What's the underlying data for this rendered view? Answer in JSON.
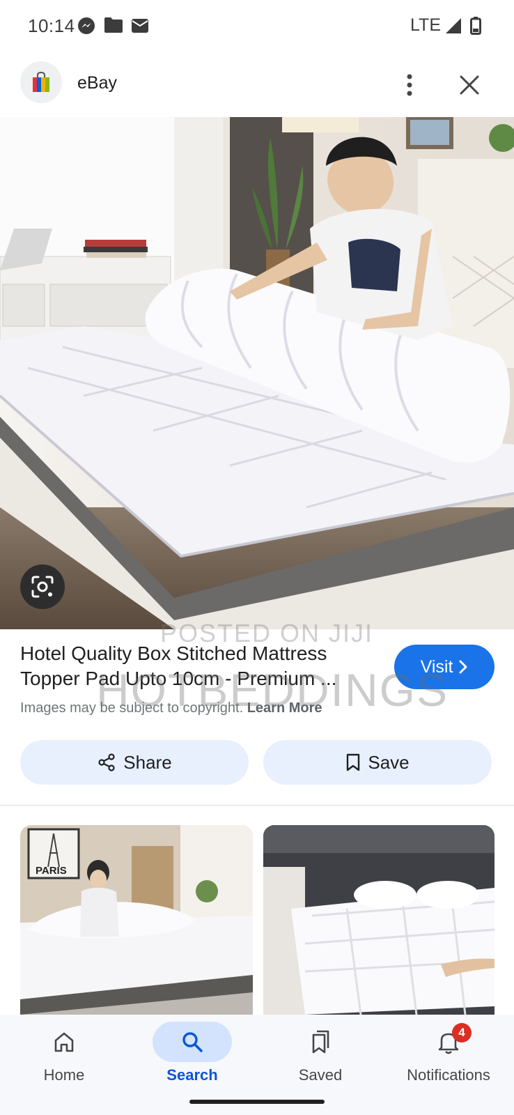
{
  "status_bar": {
    "time": "10:14",
    "network": "LTE"
  },
  "header": {
    "title": "eBay"
  },
  "result": {
    "title_line1": "Hotel Quality Box Stitched Mattress",
    "title_line2": "Topper Pad Upto 10cm - Premium ...",
    "visit_label": "Visit",
    "copyright_text": "Images may be subject to copyright.",
    "learn_more": "Learn More"
  },
  "actions": {
    "share_label": "Share",
    "save_label": "Save"
  },
  "watermark": {
    "line1": "POSTED ON JIJI",
    "line2": "HOTBEDDINGS"
  },
  "thumbnails": {
    "left_poster_text": "PARIS"
  },
  "bottom_nav": {
    "items": [
      {
        "label": "Home",
        "icon": "home-icon",
        "active": false
      },
      {
        "label": "Search",
        "icon": "search-icon",
        "active": true
      },
      {
        "label": "Saved",
        "icon": "saved-icon",
        "active": false
      },
      {
        "label": "Notifications",
        "icon": "bell-icon",
        "active": false,
        "badge": "4"
      }
    ]
  },
  "colors": {
    "accent": "#1a73e8",
    "pill_bg": "#e8f0fe",
    "active_nav": "#0b57d0",
    "badge": "#d93025"
  }
}
